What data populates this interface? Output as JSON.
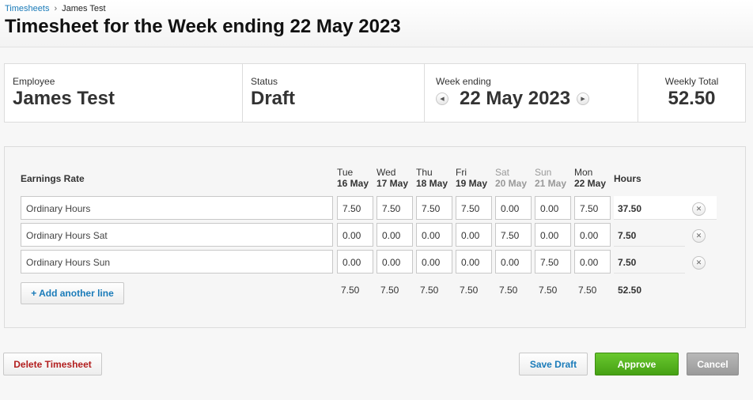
{
  "breadcrumb": {
    "parent": "Timesheets",
    "separator": "›",
    "current": "James Test"
  },
  "page_title": "Timesheet for the Week ending 22 May 2023",
  "summary": {
    "employee_label": "Employee",
    "employee": "James Test",
    "status_label": "Status",
    "status": "Draft",
    "week_label": "Week ending",
    "week": "22 May 2023",
    "prev_icon": "◀",
    "next_icon": "▶",
    "total_label": "Weekly Total",
    "total": "52.50"
  },
  "grid": {
    "rate_header": "Earnings Rate",
    "hours_header": "Hours",
    "days": [
      {
        "day": "Tue",
        "date": "16 May"
      },
      {
        "day": "Wed",
        "date": "17 May"
      },
      {
        "day": "Thu",
        "date": "18 May"
      },
      {
        "day": "Fri",
        "date": "19 May"
      },
      {
        "day": "Sat",
        "date": "20 May"
      },
      {
        "day": "Sun",
        "date": "21 May"
      },
      {
        "day": "Mon",
        "date": "22 May"
      }
    ],
    "rows": [
      {
        "rate": "Ordinary Hours",
        "values": [
          "7.50",
          "7.50",
          "7.50",
          "7.50",
          "0.00",
          "0.00",
          "7.50"
        ],
        "hours": "37.50"
      },
      {
        "rate": "Ordinary Hours Sat",
        "values": [
          "0.00",
          "0.00",
          "0.00",
          "0.00",
          "7.50",
          "0.00",
          "0.00"
        ],
        "hours": "7.50"
      },
      {
        "rate": "Ordinary Hours Sun",
        "values": [
          "0.00",
          "0.00",
          "0.00",
          "0.00",
          "0.00",
          "7.50",
          "0.00"
        ],
        "hours": "7.50"
      }
    ],
    "delete_icon": "✕",
    "add_line": "+ Add another line",
    "totals": [
      "7.50",
      "7.50",
      "7.50",
      "7.50",
      "7.50",
      "7.50",
      "7.50"
    ],
    "grand_total": "52.50"
  },
  "actions": {
    "delete": "Delete Timesheet",
    "save": "Save Draft",
    "approve": "Approve",
    "cancel": "Cancel"
  }
}
